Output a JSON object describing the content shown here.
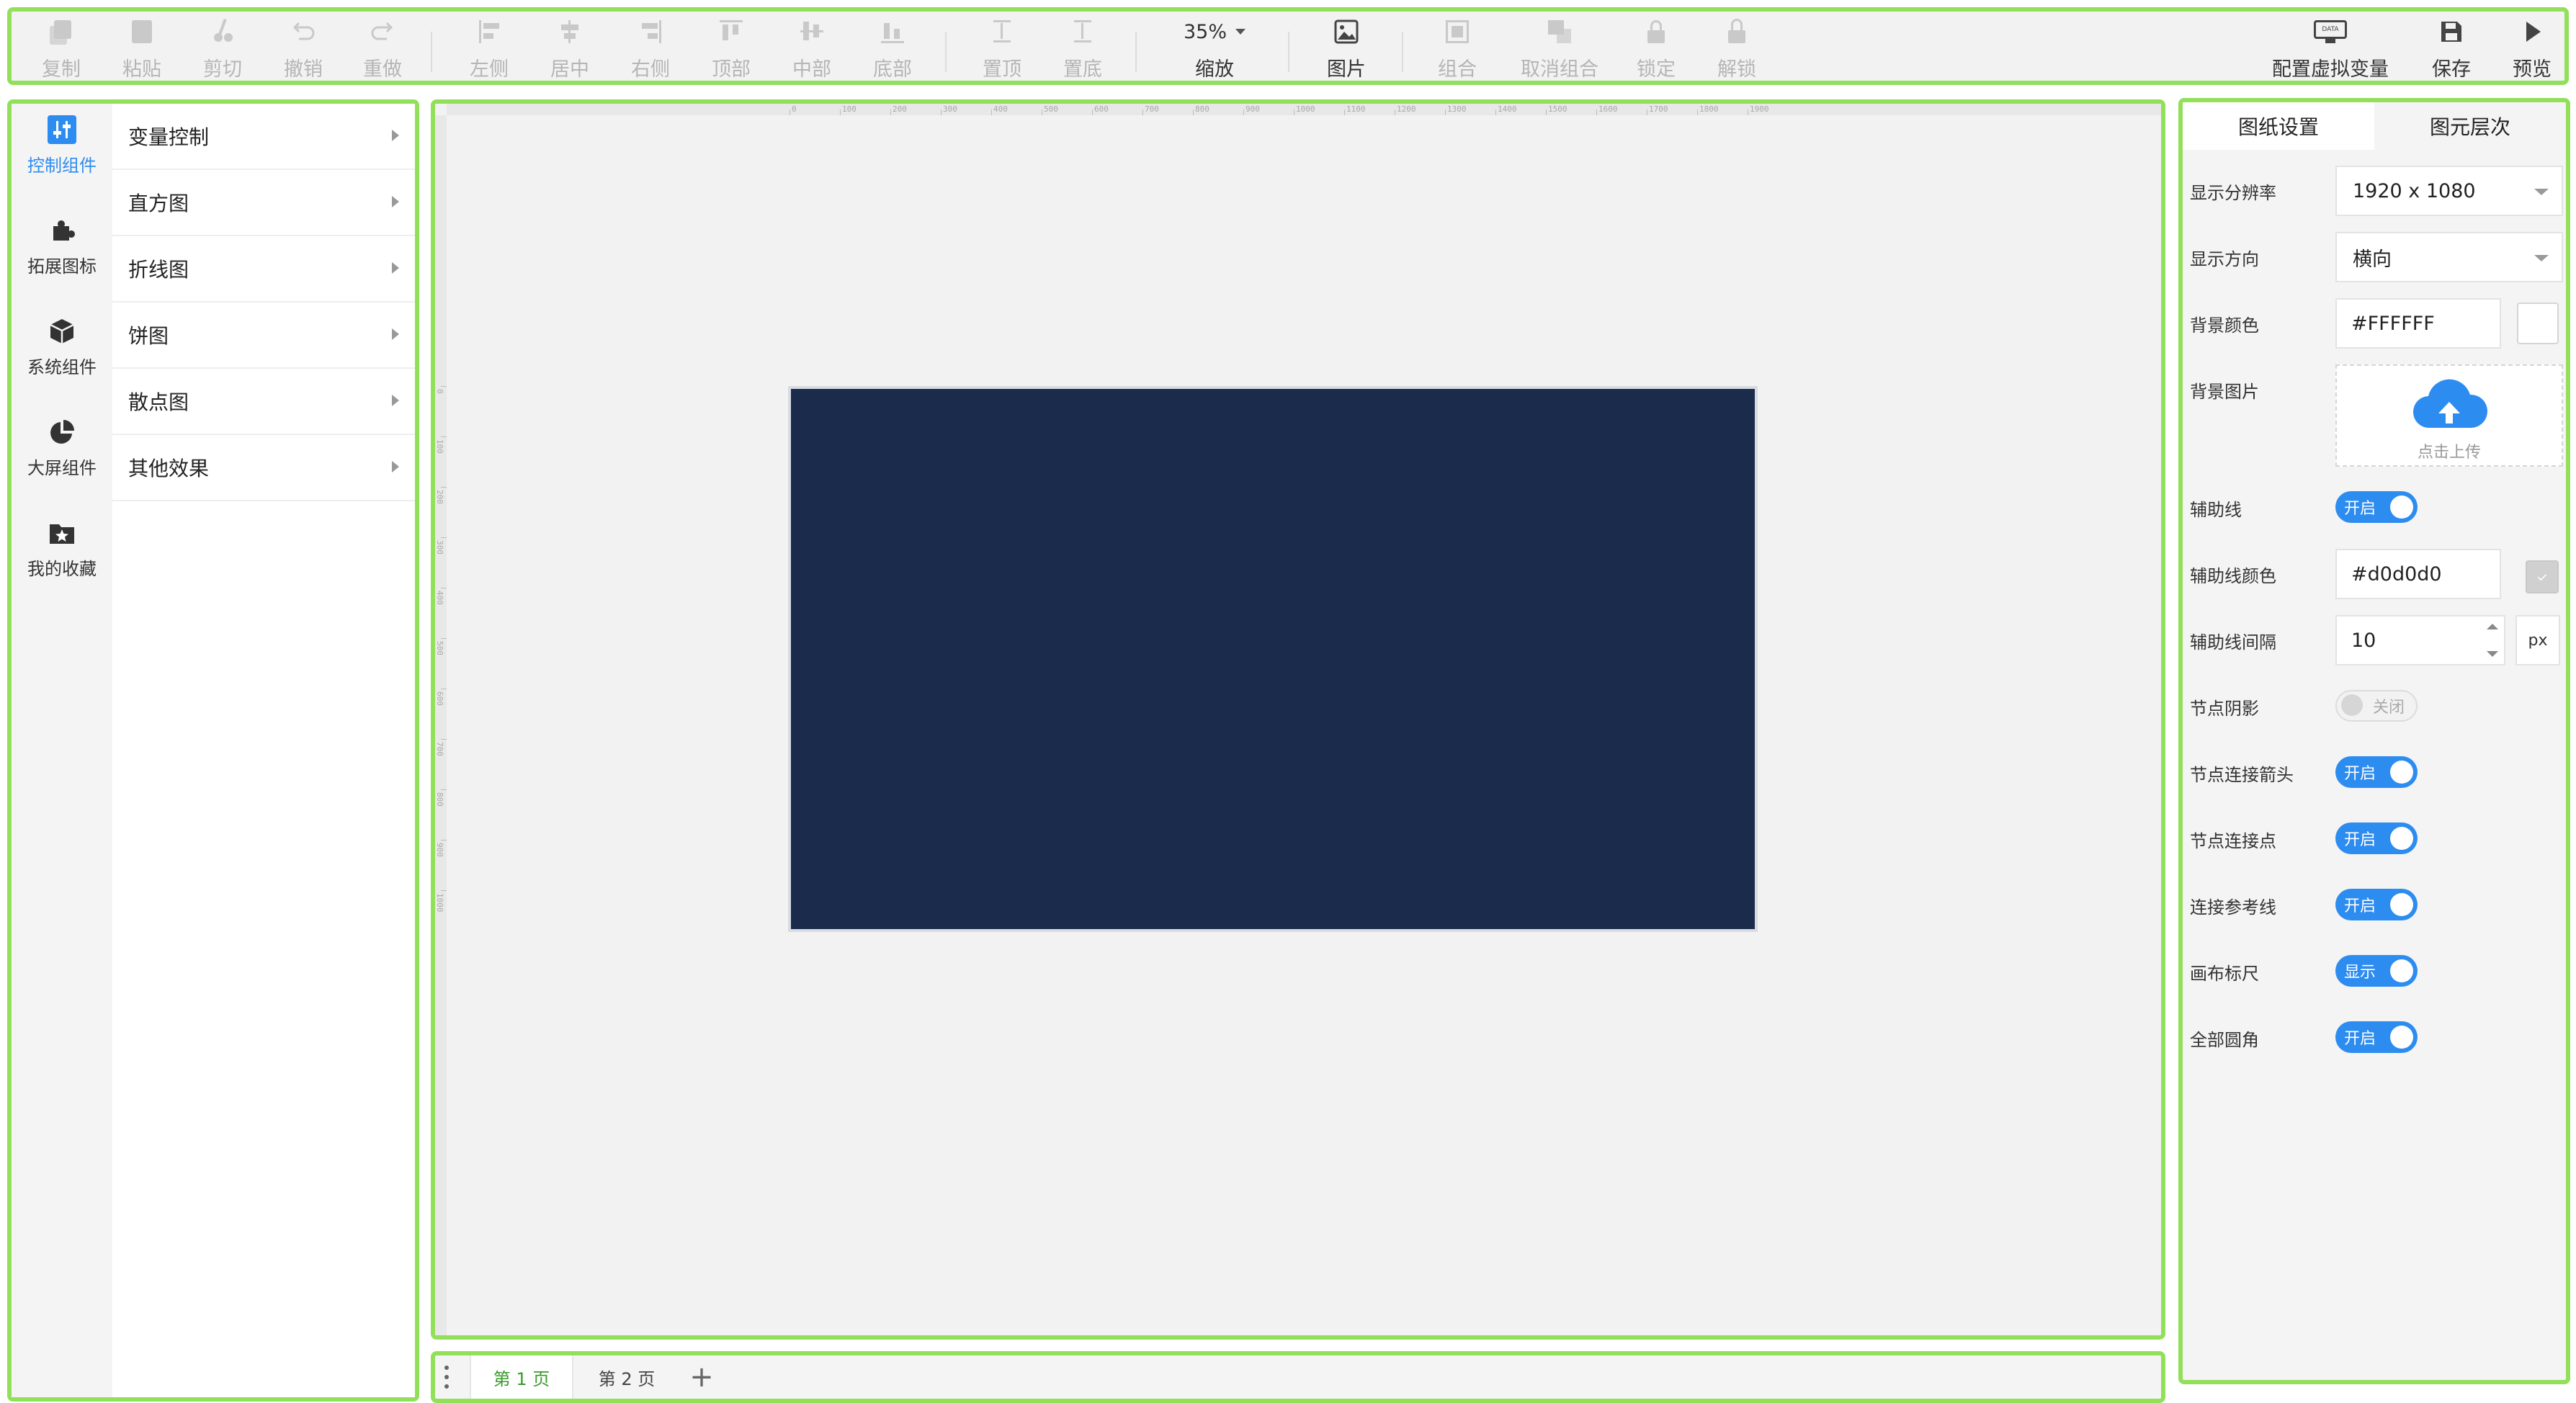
{
  "toolbar": {
    "copy": "复制",
    "paste": "粘贴",
    "cut": "剪切",
    "undo": "撤销",
    "redo": "重做",
    "left": "左侧",
    "center": "居中",
    "right": "右侧",
    "top": "顶部",
    "middle": "中部",
    "bottom": "底部",
    "to_top": "置顶",
    "to_bottom": "置底",
    "zoom_value": "35%",
    "zoom_label": "缩放",
    "image": "图片",
    "group": "组合",
    "ungroup": "取消组合",
    "lock": "锁定",
    "unlock": "解锁",
    "virtual_vars": "配置虚拟变量",
    "save": "保存",
    "preview": "预览",
    "data_badge": "DATA"
  },
  "sidebar": {
    "rail": [
      {
        "label": "控制组件",
        "icon": "sliders-icon",
        "active": true
      },
      {
        "label": "拓展图标",
        "icon": "puzzle-icon"
      },
      {
        "label": "系统组件",
        "icon": "cube-icon"
      },
      {
        "label": "大屏组件",
        "icon": "pie-chart-icon"
      },
      {
        "label": "我的收藏",
        "icon": "star-folder-icon"
      }
    ],
    "items": [
      {
        "label": "变量控制"
      },
      {
        "label": "直方图"
      },
      {
        "label": "折线图"
      },
      {
        "label": "饼图"
      },
      {
        "label": "散点图"
      },
      {
        "label": "其他效果"
      }
    ]
  },
  "canvas": {
    "ruler_top": [
      "0",
      "100",
      "200",
      "300",
      "400",
      "500",
      "600",
      "700",
      "800",
      "900",
      "1000",
      "1100",
      "1200",
      "1300",
      "1400",
      "1500",
      "1600",
      "1700",
      "1800",
      "1900"
    ],
    "ruler_left": [
      "0",
      "100",
      "200",
      "300",
      "400",
      "500",
      "600",
      "700",
      "800",
      "900",
      "1000"
    ],
    "artboard_color": "#1a2b4c"
  },
  "pages": {
    "tabs": [
      {
        "label": "第 1 页",
        "active": true
      },
      {
        "label": "第 2 页",
        "active": false
      }
    ],
    "add_label": "+"
  },
  "right_panel": {
    "tabs": [
      {
        "label": "图纸设置",
        "active": true
      },
      {
        "label": "图元层次",
        "active": false
      }
    ],
    "resolution": {
      "label": "显示分辨率",
      "value": "1920 x 1080"
    },
    "orientation": {
      "label": "显示方向",
      "value": "横向"
    },
    "bg_color": {
      "label": "背景颜色",
      "value": "#FFFFFF"
    },
    "bg_image": {
      "label": "背景图片",
      "upload_text": "点击上传"
    },
    "guides": {
      "label": "辅助线",
      "state": "开启"
    },
    "guide_color": {
      "label": "辅助线颜色",
      "value": "#d0d0d0"
    },
    "guide_spacing": {
      "label": "辅助线间隔",
      "value": "10",
      "unit": "px"
    },
    "node_shadow": {
      "label": "节点阴影",
      "state": "关闭"
    },
    "node_arrow": {
      "label": "节点连接箭头",
      "state": "开启"
    },
    "node_points": {
      "label": "节点连接点",
      "state": "开启"
    },
    "ref_lines": {
      "label": "连接参考线",
      "state": "开启"
    },
    "ruler": {
      "label": "画布标尺",
      "state": "显示"
    },
    "rounded": {
      "label": "全部圆角",
      "state": "开启"
    }
  },
  "colors": {
    "accent": "#2d8cf0",
    "region_border": "#92e05a",
    "page_tab_active": "#3a9a2a"
  }
}
